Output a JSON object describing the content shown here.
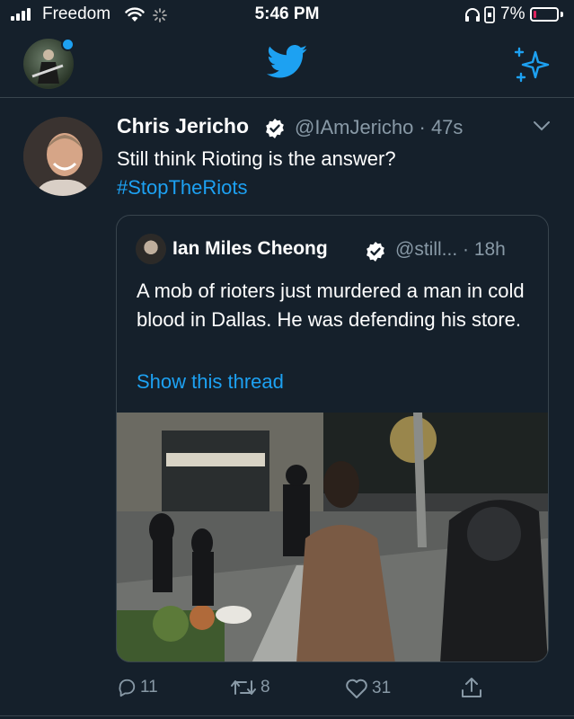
{
  "status_bar": {
    "carrier": "Freedom",
    "time": "5:46 PM",
    "battery_percent": "7%"
  },
  "tweet": {
    "author_name": "Chris Jericho",
    "author_handle": "@IAmJericho",
    "time_ago": "· 47s",
    "text": "Still think Rioting is the answer?",
    "hashtag": "#StopTheRiots",
    "quoted": {
      "author_name": "Ian Miles Cheong",
      "author_handle": "@still...",
      "time_ago": "· 18h",
      "text": "A mob of rioters just murdered a man in cold blood in Dallas. He was defending his store.",
      "show_thread": "Show this thread"
    },
    "actions": {
      "replies": "11",
      "retweets": "8",
      "likes": "31"
    }
  },
  "colors": {
    "background": "#15202b",
    "accent": "#1da1f2",
    "secondary_text": "#8899a6",
    "divider": "#38444d"
  },
  "icons": [
    "wifi-icon",
    "activity-spinner-icon",
    "headphones-icon",
    "lock-rotation-icon",
    "twitter-bird-icon",
    "sparkle-icon",
    "verified-badge-icon",
    "chevron-down-icon",
    "reply-icon",
    "retweet-icon",
    "like-icon",
    "share-icon"
  ]
}
